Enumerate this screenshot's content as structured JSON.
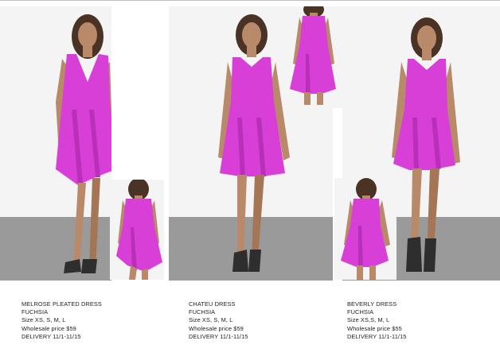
{
  "products": [
    {
      "name": "MELROSE PLEATED DRESS",
      "color": "FUCHSIA",
      "size": "Size XS, S, M, L",
      "price": "Wholesale price $59",
      "delivery": "DELIVERY 11/1-11/15"
    },
    {
      "name": "CHATEU DRESS",
      "color": "FUCHSIA",
      "size": "Size XS, S, M, L",
      "price": "Wholesale price $59",
      "delivery": "DELIVERY 11/1-11/15"
    },
    {
      "name": "BEVERLY DRESS",
      "color": "FUCHSIA",
      "size": "Size XS,S, M, L",
      "price": "Wholesale price $55",
      "delivery": "DELIVERY 11/1-11/15"
    }
  ],
  "colors": {
    "dress": "#d83fd6",
    "background": "#f4f4f4",
    "floor": "#9a9a9a"
  }
}
